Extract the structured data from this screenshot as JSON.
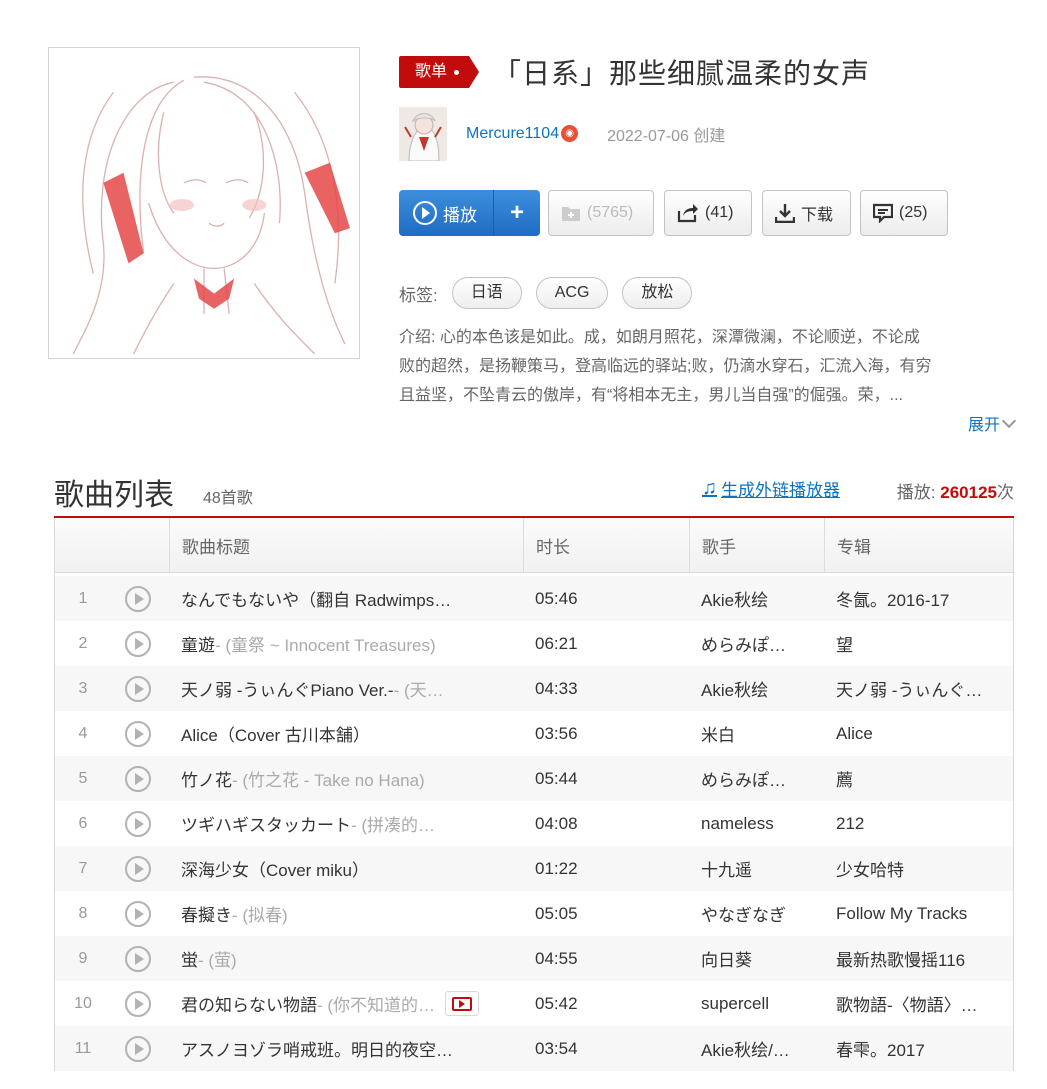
{
  "playlist": {
    "badge": "歌单",
    "title": "「日系」那些细腻温柔的女声",
    "creator": "Mercure1104",
    "created": "2022-07-06 创建",
    "play_label": "播放",
    "add_label": "+",
    "fav_count": "(5765)",
    "share_count": "(41)",
    "download_label": "下载",
    "comment_count": "(25)",
    "tags_label": "标签:",
    "tags": [
      "日语",
      "ACG",
      "放松"
    ],
    "intro_lines": [
      "介绍:  心的本色该是如此。成，如朗月照花，深潭微澜，不论顺逆，不论成",
      "败的超然，是扬鞭策马，登高临远的驿站;败，仍滴水穿石，汇流入海，有穷",
      "且益坚，不坠青云的傲岸，有“将相本无主，男儿当自强”的倔强。荣，..."
    ],
    "expand_label": "展开"
  },
  "list": {
    "title": "歌曲列表",
    "count": "48首歌",
    "outer_link": "生成外链播放器",
    "play_label": "播放:",
    "play_count": "260125",
    "play_unit": "次",
    "columns": [
      "",
      "歌曲标题",
      "时长",
      "歌手",
      "专辑"
    ]
  },
  "songs": [
    {
      "idx": "1",
      "title": "なんでもないや（翻自 Radwimps…",
      "sub": "",
      "dur": "05:46",
      "artist": "Akie秋绘",
      "album": "冬氤。2016-17",
      "mv": false
    },
    {
      "idx": "2",
      "title": "童遊",
      "sub": " - (童祭 ~ Innocent Treasures)",
      "dur": "06:21",
      "artist": "めらみぽ…",
      "album": "望",
      "mv": false
    },
    {
      "idx": "3",
      "title": "天ノ弱 -うぃんぐPiano Ver.-",
      "sub": " - (天…",
      "dur": "04:33",
      "artist": "Akie秋绘",
      "album": "天ノ弱 -うぃんぐ…",
      "mv": false
    },
    {
      "idx": "4",
      "title": "Alice（Cover 古川本舗）",
      "sub": "",
      "dur": "03:56",
      "artist": "米白",
      "album": "Alice",
      "mv": false
    },
    {
      "idx": "5",
      "title": "竹ノ花",
      "sub": " - (竹之花 - Take no Hana)",
      "dur": "05:44",
      "artist": "めらみぽ…",
      "album": "薦",
      "mv": false
    },
    {
      "idx": "6",
      "title": "ツギハギスタッカート",
      "sub": " - (拼凑的…",
      "dur": "04:08",
      "artist": "nameless",
      "album": "212",
      "mv": false
    },
    {
      "idx": "7",
      "title": "深海少女（Cover miku）",
      "sub": "",
      "dur": "01:22",
      "artist": "十九遥",
      "album": "少女哈特",
      "mv": false
    },
    {
      "idx": "8",
      "title": "春擬き",
      "sub": " - (拟春)",
      "dur": "05:05",
      "artist": "やなぎなぎ",
      "album": "Follow My Tracks",
      "mv": false
    },
    {
      "idx": "9",
      "title": "蛍",
      "sub": " - (萤)",
      "dur": "04:55",
      "artist": "向日葵",
      "album": "最新热歌慢摇116",
      "mv": false
    },
    {
      "idx": "10",
      "title": "君の知らない物語",
      "sub": " - (你不知道的…",
      "dur": "05:42",
      "artist": "supercell",
      "album": "歌物語-〈物語〉…",
      "mv": true
    },
    {
      "idx": "11",
      "title": "アスノヨゾラ哨戒班。明日的夜空…",
      "sub": "",
      "dur": "03:54",
      "artist": "Akie秋绘/…",
      "album": "春雫。2017",
      "mv": false
    }
  ]
}
